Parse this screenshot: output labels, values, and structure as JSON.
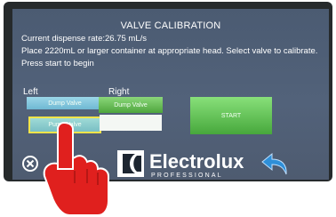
{
  "screen": {
    "title": "VALVE CALIBRATION",
    "dispense_rate": "Current dispense rate:26.75 mL/s",
    "instruction": "Place 2220mL or larger container at appropriate head. Select valve to calibrate.",
    "prompt": "Press start to begin"
  },
  "columns": {
    "left_label": "Left",
    "right_label": "Right"
  },
  "buttons": {
    "left_valve_1": "Dump Valve",
    "left_valve_2": "Pump Valve",
    "right_valve_1": "Dump Valve",
    "right_valve_2": "",
    "start": "START"
  },
  "brand": {
    "name": "Electrolux",
    "sub": "PROFESSIONAL"
  },
  "icons": {
    "close": "close-icon",
    "back": "back-arrow-icon",
    "logo": "electrolux-logo-icon",
    "hand": "pointing-hand-icon"
  },
  "colors": {
    "screen_bg": "#4e5d74",
    "green_button": "#4ea53d",
    "blue_button": "#7bbfd8",
    "selection_border": "#f2e44a",
    "hand": "#e0201e",
    "back_arrow": "#2f8fd8"
  }
}
